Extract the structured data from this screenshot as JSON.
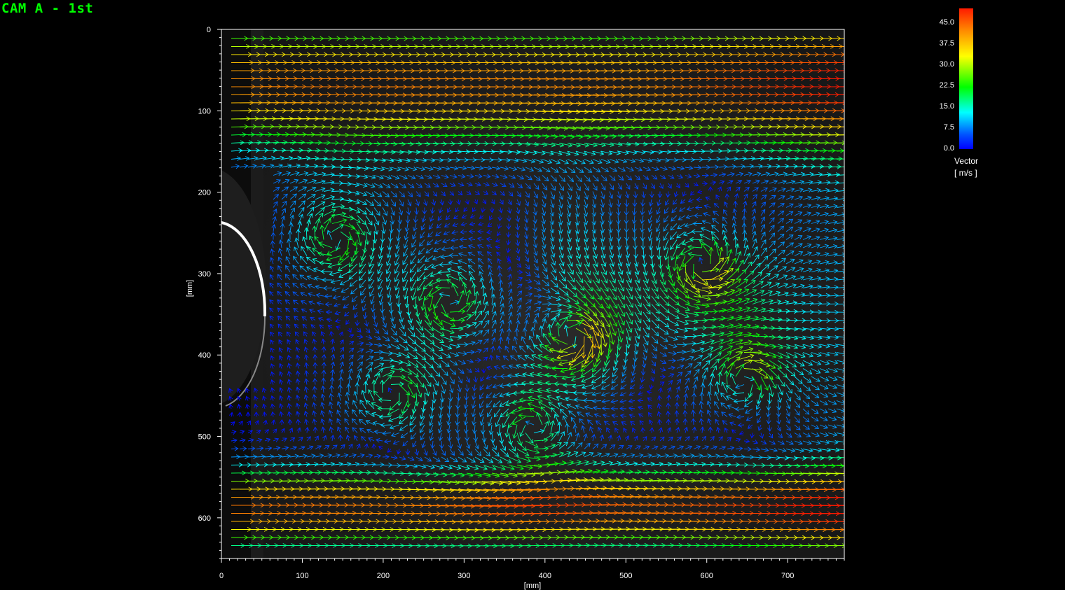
{
  "window": {
    "title": "CAM A - 1st"
  },
  "plot": {
    "x_axis": {
      "label": "[mm]",
      "ticks": [
        "0",
        "100",
        "200",
        "300",
        "400",
        "500",
        "600",
        "700"
      ],
      "tick_values": [
        0,
        100,
        200,
        300,
        400,
        500,
        600,
        700
      ],
      "range": [
        0,
        770
      ]
    },
    "y_axis": {
      "label": "[mm]",
      "ticks": [
        "0",
        "100",
        "200",
        "300",
        "400",
        "500",
        "600"
      ],
      "tick_values": [
        0,
        100,
        200,
        300,
        400,
        500,
        600
      ],
      "range": [
        0,
        650
      ],
      "inverted": true
    },
    "background": "grayscale camera image of flow domain with a bright circular arc (cylinder edge) at the left",
    "vector_field": "velocity vectors colored by magnitude"
  },
  "colorbar": {
    "ticks": [
      "45.0",
      "37.5",
      "30.0",
      "22.5",
      "15.0",
      "7.5",
      "0.0"
    ],
    "name": "Vector",
    "unit": "[ m/s ]",
    "range": [
      0,
      48
    ],
    "colors": [
      "#0000ff",
      "#00ffff",
      "#00ff00",
      "#ffff00",
      "#ff8c00",
      "#ff1a00"
    ]
  },
  "colors": {
    "title": "#00ff00",
    "background": "#000000",
    "text": "#ffffff"
  }
}
